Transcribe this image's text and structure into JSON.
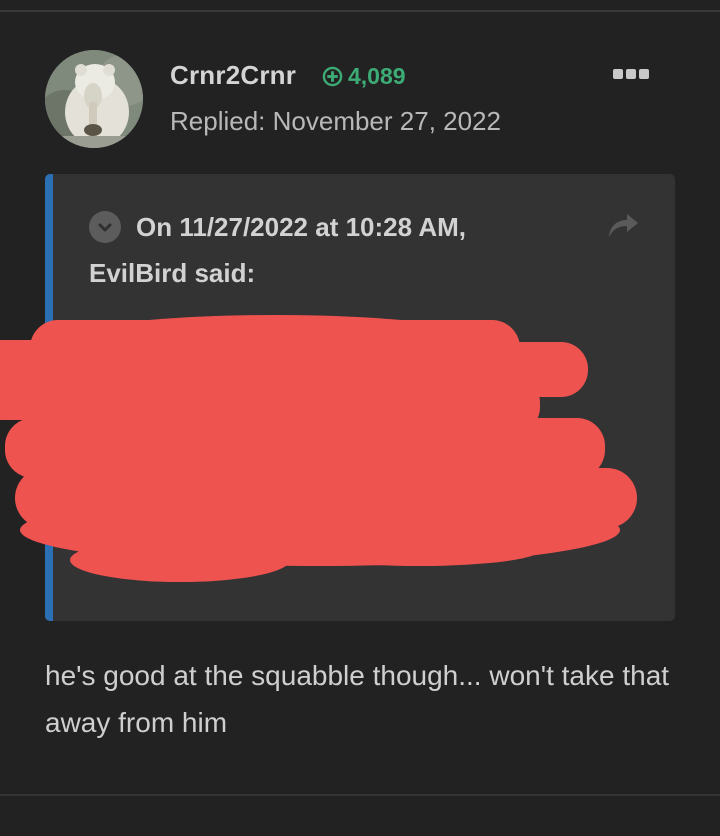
{
  "post": {
    "author": "Crnr2Crnr",
    "reputation": "4,089",
    "reply_date": "Replied: November 27, 2022",
    "icons": {
      "avatar": "polar-bear-avatar",
      "reputation": "plus-circle-icon",
      "more": "more-options-icon"
    },
    "quote": {
      "header_line1": "On 11/27/2022 at 10:28 AM,",
      "header_line2": "EvilBird said:",
      "content_redacted": true,
      "icons": {
        "toggle": "chevron-down-circle-icon",
        "share": "share-arrow-icon"
      }
    },
    "body": "he's good at the squabble though... won't take that away from him"
  },
  "colors": {
    "background": "#222223",
    "quote_background": "#333334",
    "quote_bar": "#2b6fb4",
    "reputation": "#3dab75",
    "redaction": "#ef5350"
  }
}
